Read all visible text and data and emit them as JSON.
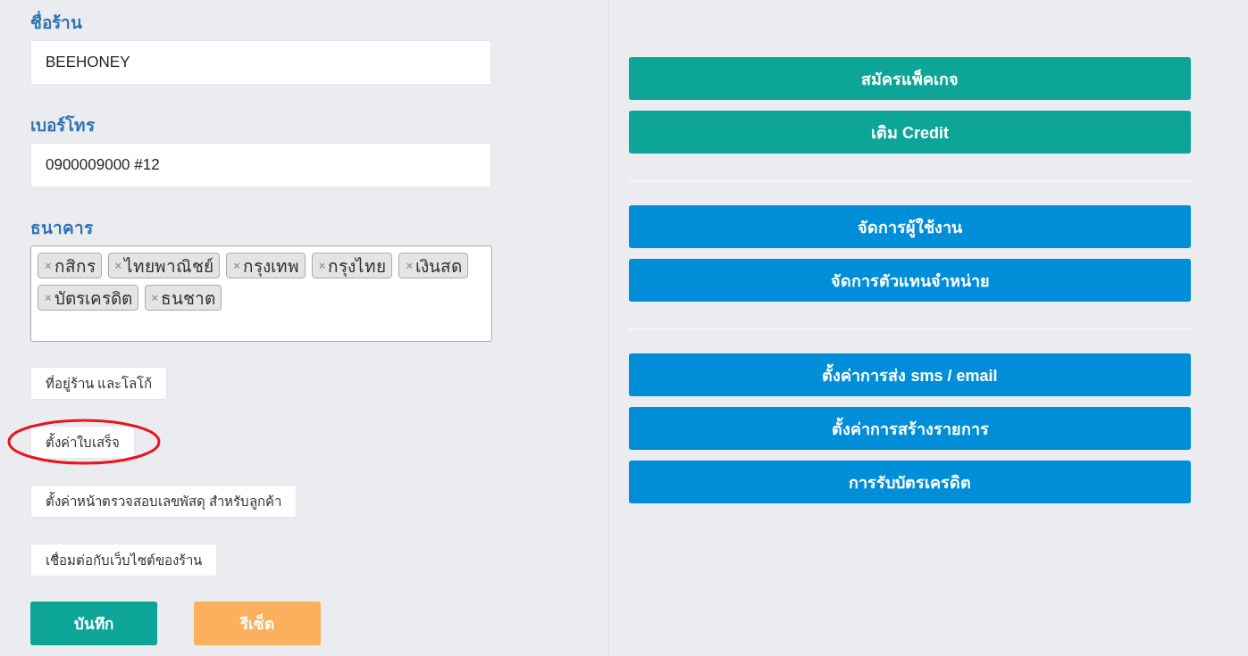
{
  "form": {
    "fields": [
      {
        "label": "ชื่อร้าน",
        "value": "BEEHONEY"
      },
      {
        "label": "เบอร์โทร",
        "value": "0900009000 #12"
      }
    ],
    "banks": {
      "label": "ธนาคาร",
      "tags": [
        {
          "remove": "×",
          "text": "กสิกร"
        },
        {
          "remove": "×",
          "text": "ไทยพาณิชย์"
        },
        {
          "remove": "×",
          "text": "กรุงเทพ"
        },
        {
          "remove": "×",
          "text": "กรุงไทย"
        },
        {
          "remove": "×",
          "text": "เงินสด"
        },
        {
          "remove": "×",
          "text": "บัตรเครดิต"
        },
        {
          "remove": "×",
          "text": "ธนชาต"
        }
      ]
    },
    "links": [
      {
        "label": "ที่อยู่ร้าน และโลโก้",
        "circled": false
      },
      {
        "label": "ตั้งค่าใบเสร็จ",
        "circled": true
      },
      {
        "label": "ตั้งค่าหน้าตรวจสอบเลขพัสดุ สำหรับลูกค้า",
        "circled": false
      },
      {
        "label": "เชื่อมต่อกับเว็บไซต์ของร้าน",
        "circled": false
      }
    ],
    "actions": [
      {
        "label": "บันทึก",
        "kind": "save"
      },
      {
        "label": "รีเซ็ต",
        "kind": "reset"
      }
    ]
  },
  "menu": {
    "groups": [
      {
        "buttons": [
          {
            "label": "สมัครแพ็คเกจ",
            "kind": "success"
          },
          {
            "label": "เติม Credit",
            "kind": "success"
          }
        ]
      },
      {
        "buttons": [
          {
            "label": "จัดการผู้ใช้งาน",
            "kind": "primary"
          },
          {
            "label": "จัดการตัวแทนจำหน่าย",
            "kind": "primary"
          }
        ]
      },
      {
        "buttons": [
          {
            "label": "ตั้งค่าการส่ง sms / email",
            "kind": "primary"
          },
          {
            "label": "ตั้งค่าการสร้างรายการ",
            "kind": "primary"
          },
          {
            "label": "การรับบัตรเครดิต",
            "kind": "primary"
          }
        ]
      }
    ]
  }
}
